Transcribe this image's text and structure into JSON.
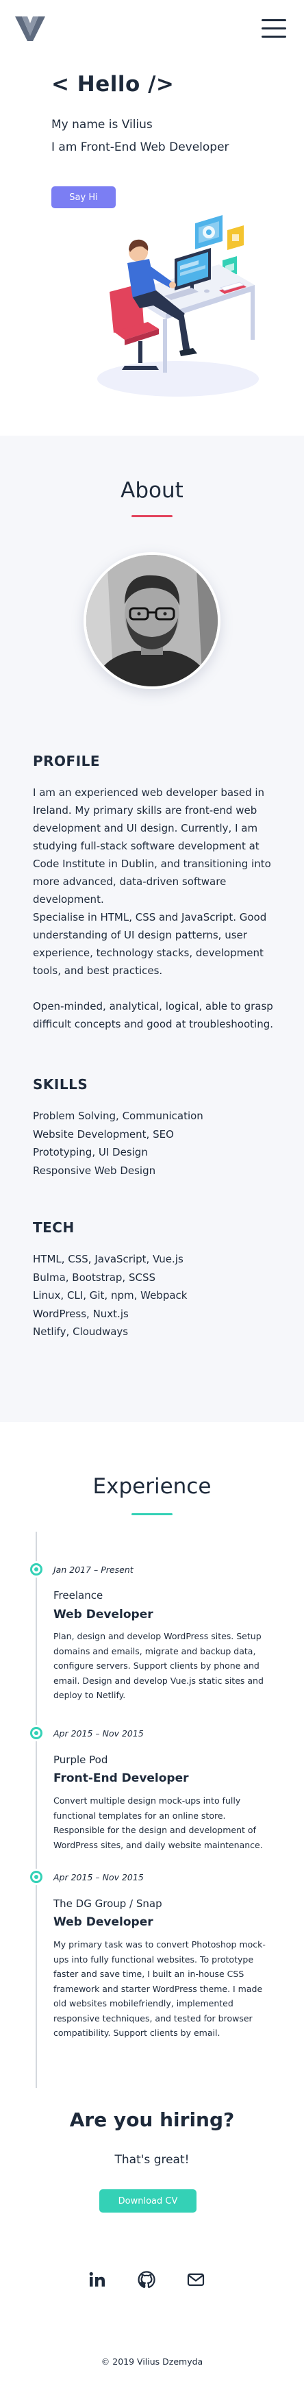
{
  "header": {
    "logo_icon": "v-logo-icon",
    "menu_icon": "hamburger-menu-icon"
  },
  "hero": {
    "heading": "< Hello />",
    "line1": "My name is Vilius",
    "line2": "I am Front-End Web Developer",
    "button": "Say Hi",
    "illustration_icon": "developer-at-desk-illustration"
  },
  "about": {
    "title": "About",
    "avatar_icon": "profile-photo",
    "profile_heading": "PROFILE",
    "profile_paragraphs": [
      "I am an experienced web developer based in Ireland. My primary skills are front-end web development and UI design. Currently, I am studying full-stack software development at Code Institute in Dublin, and transitioning into more advanced, data-driven software development.",
      "Specialise in HTML, CSS and JavaScript. Good understanding of UI design patterns, user experience, technology stacks, development tools, and best practices.",
      "Open-minded, analytical, logical, able to grasp difficult concepts and good at troubleshooting."
    ],
    "skills_heading": "SKILLS",
    "skills": [
      "Problem Solving, Communication",
      "Website Development, SEO",
      "Prototyping, UI Design",
      "Responsive Web Design"
    ],
    "tech_heading": "TECH",
    "tech": [
      "HTML, CSS, JavaScript, Vue.js",
      "Bulma, Bootstrap, SCSS",
      "Linux, CLI, Git, npm, Webpack",
      "WordPress, Nuxt.js",
      "Netlify, Cloudways"
    ]
  },
  "experience": {
    "title": "Experience",
    "items": [
      {
        "date": "Jan 2017 – Present",
        "company": "Freelance",
        "role": "Web Developer",
        "description": "Plan, design and develop WordPress sites. Setup domains and emails, migrate and backup data, configure servers. Support clients by phone and email. Design and develop Vue.js static sites and deploy to Netlify."
      },
      {
        "date": "Apr 2015 – Nov 2015",
        "company": "Purple Pod",
        "role": "Front-End Developer",
        "description": "Convert multiple design mock-ups into fully functional templates for an online store. Responsible for the design and development of WordPress sites, and daily website maintenance."
      },
      {
        "date": "Apr 2015 – Nov 2015",
        "company": "The DG Group / Snap",
        "role": "Web Developer",
        "description": "My primary task was to convert Photoshop mock-ups into fully functional websites. To prototype faster and save time, I built an in-house CSS framework and starter WordPress theme. I made old websites mobilefriendly, implemented responsive techniques, and tested for browser compatibility. Support clients by email."
      }
    ],
    "hiring_heading": "Are you hiring?",
    "hiring_text": "That's great!",
    "download_button": "Download CV"
  },
  "footer": {
    "social_icons": [
      "linkedin-icon",
      "github-icon",
      "email-icon"
    ],
    "copyright": "© 2019 Vilius Dzemyda"
  },
  "colors": {
    "primary_text": "#1e2a3b",
    "say_hi_button": "#7b7ef3",
    "about_accent": "#e2435c",
    "experience_accent": "#34d1b6",
    "about_background": "#f6f7fa"
  }
}
